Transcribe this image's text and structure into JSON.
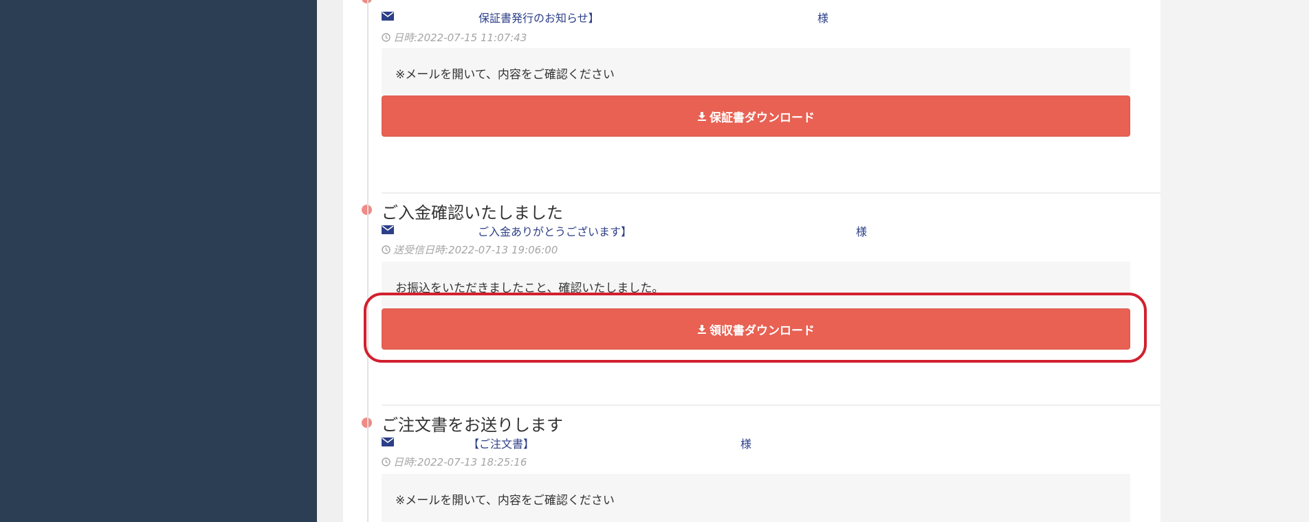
{
  "colors": {
    "sidebar": "#2c3e53",
    "accent_button": "#e86153",
    "timeline_dot": "#f08a86",
    "link_text": "#2c3f88",
    "highlight_ring": "#d2202f"
  },
  "timeline": [
    {
      "title": "",
      "subject": "保証書発行のお知らせ】",
      "recipient_suffix": "様",
      "datetime": "日時:2022-07-15 11:07:43",
      "message": "※メールを開いて、内容をご確認ください",
      "button_label": "保証書ダウンロード",
      "button_icon": "download-icon"
    },
    {
      "title": "ご入金確認いたしました",
      "subject": "ご入金ありがとうございます】",
      "recipient_suffix": "様",
      "datetime": "送受信日時:2022-07-13 19:06:00",
      "message": "お振込をいただきましたこと、確認いたしました。",
      "button_label": "領収書ダウンロード",
      "button_icon": "download-icon"
    },
    {
      "title": "ご注文書をお送りします",
      "subject": "【ご注文書】",
      "recipient_suffix": "様",
      "datetime": "日時:2022-07-13 18:25:16",
      "message": "※メールを開いて、内容をご確認ください"
    }
  ]
}
